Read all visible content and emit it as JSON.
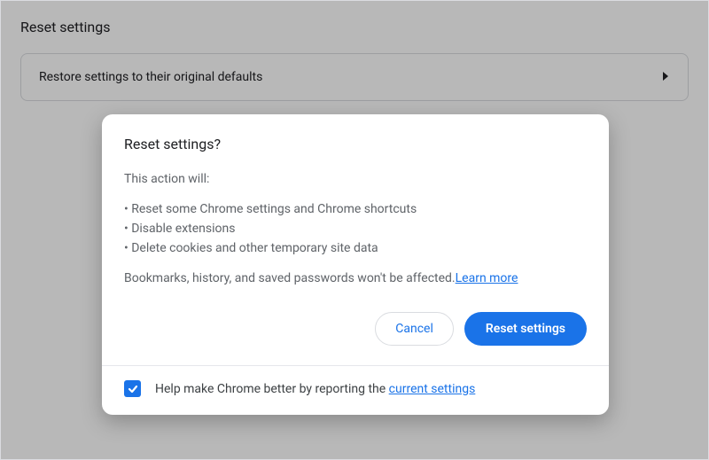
{
  "page": {
    "title": "Reset settings",
    "row_label": "Restore settings to their original defaults"
  },
  "dialog": {
    "title": "Reset settings?",
    "intro": "This action will:",
    "bullets": [
      "Reset some Chrome settings and Chrome shortcuts",
      "Disable extensions",
      "Delete cookies and other temporary site data"
    ],
    "note_prefix": "Bookmarks, history, and saved passwords won't be affected.",
    "learn_more": "Learn more",
    "cancel": "Cancel",
    "confirm": "Reset settings",
    "footer_prefix": "Help make Chrome better by reporting the ",
    "footer_link": "current settings",
    "checkbox_checked": true
  }
}
